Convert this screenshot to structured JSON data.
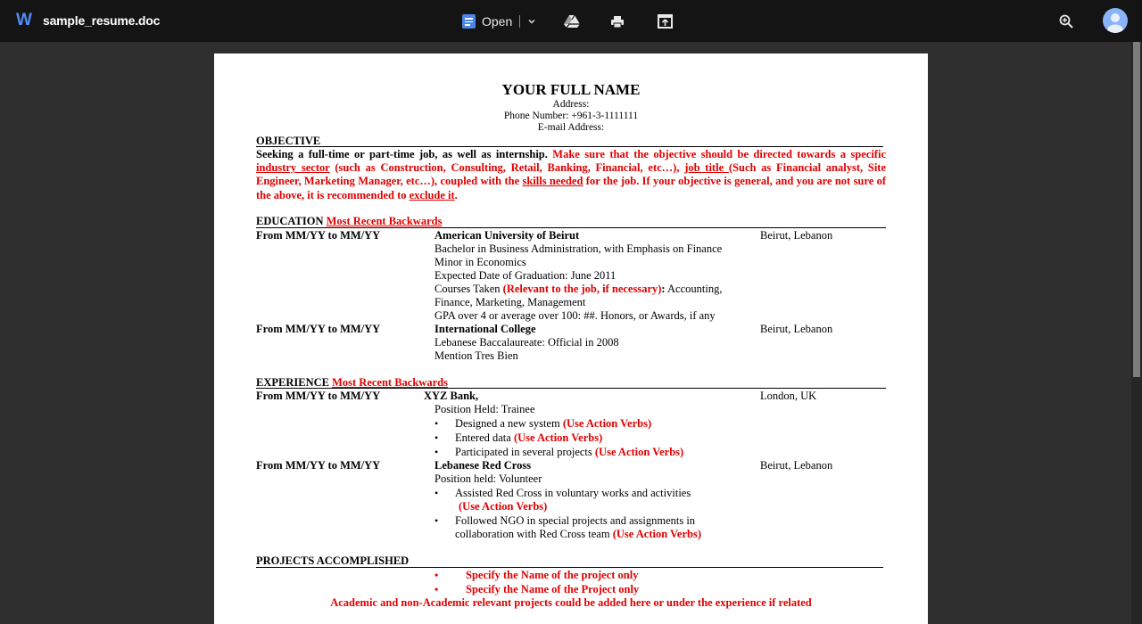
{
  "app": {
    "icon_letter": "W",
    "file_name": "sample_resume.doc",
    "open_label": "Open",
    "icons": [
      "docs-icon",
      "chevron-down-icon",
      "drive-icon",
      "print-icon",
      "open-new-window-icon",
      "zoom-in-icon",
      "avatar-icon"
    ]
  },
  "resume": {
    "name": "YOUR FULL NAME",
    "address": "Address:",
    "phone": "Phone Number: +961-3-1111111",
    "email": "E-mail Address:",
    "objective": {
      "heading": "OBJECTIVE",
      "text_black": "Seeking a full-time or part-time job, as well as internship.",
      "text_red_1": " Make sure that the objective should be directed towards a specific ",
      "link_1": "industry sector",
      "text_red_2": " (such as Construction, Consulting, Retail, Banking, Financial, etc…), ",
      "link_2": "job title ",
      "text_red_3": "(Such as Financial analyst, Site Engineer, Marketing Manager, etc…), coupled with the ",
      "link_3": "skills needed",
      "text_red_4": " for the job. If your objective is general, and you are not sure of the above, it is recommended to ",
      "link_4": "exclude it",
      "text_red_5": "."
    },
    "education": {
      "heading": "EDUCATION",
      "note": "Most Recent Backwards",
      "entries": [
        {
          "dates": "From MM/YY to MM/YY",
          "institution": "American University of Beirut",
          "location": "Beirut, Lebanon",
          "line1": "Bachelor in Business Administration, with Emphasis on Finance",
          "line2": "Minor in Economics",
          "line3": "Expected Date of Graduation: June 2011",
          "courses_prefix": "Courses Taken ",
          "courses_note": "(Relevant to the job, if necessary)",
          "courses_colon": ":",
          "courses_text_1": " Accounting,",
          "courses_text_2": "Finance, Marketing, Management",
          "line_gpa": "GPA over 4 or average over 100: ##. Honors, or Awards, if any"
        },
        {
          "dates": "From MM/YY to MM/YY",
          "institution": "International College",
          "location": "Beirut, Lebanon",
          "line1": "Lebanese Baccalaureate: Official in 2008",
          "line2": "Mention Tres Bien"
        }
      ]
    },
    "experience": {
      "heading": "EXPERIENCE",
      "note": "Most Recent Backwards",
      "entries": [
        {
          "dates": "From MM/YY to MM/YY",
          "company": "XYZ Bank,",
          "location": "London, UK",
          "position": "Position Held: Trainee",
          "bullets": [
            {
              "text": "Designed a new system ",
              "note": "(Use Action Verbs)"
            },
            {
              "text": "Entered data ",
              "note": "(Use Action Verbs)"
            },
            {
              "text": "Participated in several projects ",
              "note": "(Use Action Verbs)"
            }
          ]
        },
        {
          "dates": "From MM/YY to MM/YY",
          "company": "Lebanese Red Cross",
          "location": "Beirut, Lebanon",
          "position": "Position held: Volunteer",
          "bullet1_text": "Assisted Red Cross in voluntary works and activities",
          "bullet1_note": "(Use Action Verbs)",
          "bullet2_text_1": "Followed NGO in special projects and assignments in",
          "bullet2_text_2": "collaboration with Red Cross team ",
          "bullet2_note": "(Use Action Verbs)"
        }
      ]
    },
    "projects": {
      "heading": "PROJECTS ACCOMPLISHED",
      "bullets": [
        "Specify the Name of the project only",
        "Specify the Name of the Project only"
      ],
      "note": "Academic and non-Academic relevant projects could be added here or under the experience if related"
    }
  }
}
